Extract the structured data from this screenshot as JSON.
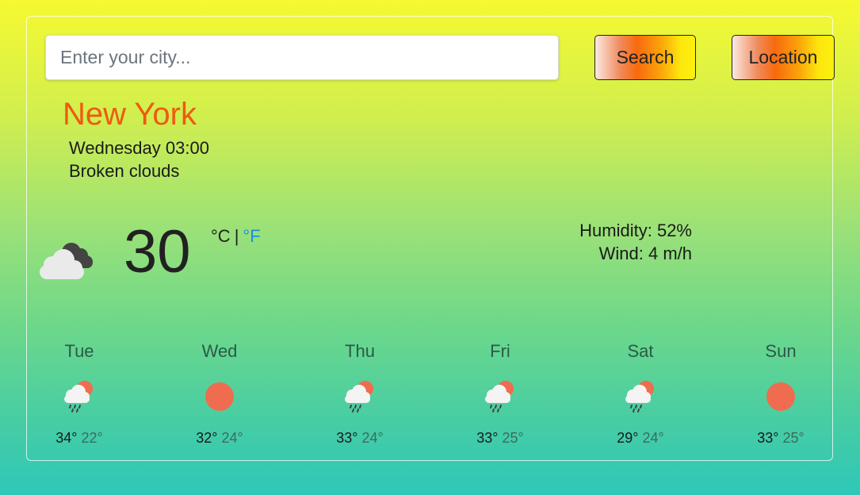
{
  "search": {
    "placeholder": "Enter your city...",
    "search_label": "Search",
    "location_label": "Location"
  },
  "current": {
    "city": "New York",
    "datetime": "Wednesday 03:00",
    "description": "Broken clouds",
    "icon": "broken-clouds-icon",
    "temperature": "30",
    "unit_c": "°C",
    "unit_sep": "|",
    "unit_f": "°F",
    "humidity": "Humidity: 52%",
    "wind": "Wind: 4 m/h"
  },
  "forecast": [
    {
      "day": "Tue",
      "icon": "rain-sun-icon",
      "max": "34°",
      "min": "22°"
    },
    {
      "day": "Wed",
      "icon": "sun-icon",
      "max": "32°",
      "min": "24°"
    },
    {
      "day": "Thu",
      "icon": "rain-sun-icon",
      "max": "33°",
      "min": "24°"
    },
    {
      "day": "Fri",
      "icon": "rain-sun-icon",
      "max": "33°",
      "min": "25°"
    },
    {
      "day": "Sat",
      "icon": "rain-sun-icon",
      "max": "29°",
      "min": "24°"
    },
    {
      "day": "Sun",
      "icon": "sun-icon",
      "max": "33°",
      "min": "25°"
    }
  ],
  "colors": {
    "accent_city": "#ee5a13",
    "link_unit": "#1a8fe0",
    "sun": "#ef6c50",
    "button_gradient": [
      "#fbe9e2",
      "#f76a0e",
      "#fdf10e"
    ]
  }
}
